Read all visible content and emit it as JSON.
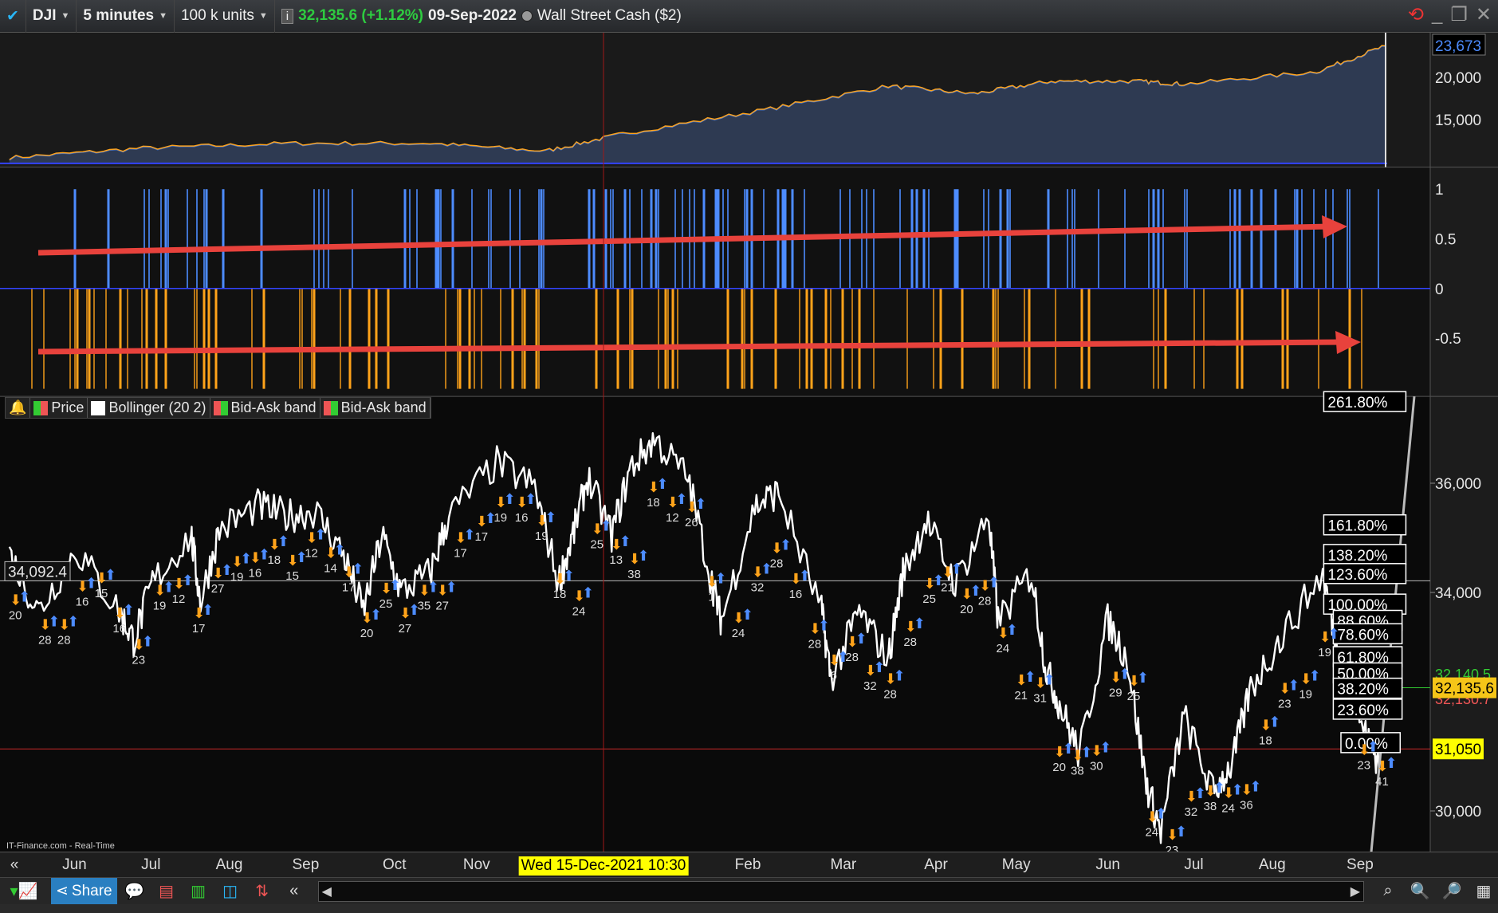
{
  "titlebar": {
    "symbol": "DJI",
    "timeframe": "5 minutes",
    "units": "100 k units",
    "price": "32,135.6 (+1.12%)",
    "date": "09-Sep-2022",
    "instrument": "Wall Street Cash ($2)"
  },
  "colors": {
    "blue": "#4d8cff",
    "orange": "#ffa31a",
    "red_arrow": "#e8423c",
    "price_line": "#ffffff",
    "yellow": "#ffff00",
    "accent": "#f5c518"
  },
  "top_panel": {
    "axis": [
      "23,673",
      "20,000",
      "15,000"
    ],
    "last": "23,673",
    "equity_keypoints": [
      [
        -0.76,
        10500
      ],
      [
        0.8,
        11632
      ],
      [
        2.5,
        12198
      ],
      [
        4.15,
        12198
      ],
      [
        5.5,
        11292
      ],
      [
        6.4,
        13330
      ],
      [
        8.05,
        16150
      ],
      [
        9.5,
        18980
      ],
      [
        10.5,
        18075
      ],
      [
        11.4,
        19547
      ],
      [
        12.4,
        19547
      ],
      [
        12.95,
        19207
      ],
      [
        14.5,
        20670
      ],
      [
        15.3,
        23726
      ]
    ]
  },
  "histogram": {
    "axis": [
      "1",
      "0.5",
      "0",
      "-0.5"
    ]
  },
  "legend": [
    "Price",
    "Bollinger (20 2)",
    "Bid-Ask band",
    "Bid-Ask band"
  ],
  "price_panel": {
    "axis": [
      {
        "v": 36000,
        "t": "36,000"
      },
      {
        "v": 34000,
        "t": "34,000"
      },
      {
        "v": 30000,
        "t": "30,000"
      }
    ],
    "cursor_price": "34,092.4",
    "last_price": "32,135.6",
    "bid": "32,140.5",
    "ask": "32,130.7",
    "level": "31,050",
    "fib_levels": [
      "261.80%",
      "161.80%",
      "138.20%",
      "123.60%",
      "100.00%",
      "88.60%",
      "78.60%",
      "61.80%",
      "50.00%",
      "38.20%",
      "23.60%",
      "0.00%"
    ],
    "price_keypoints": [
      [
        -0.76,
        34705
      ],
      [
        -0.42,
        33655
      ],
      [
        0.02,
        34793
      ],
      [
        0.52,
        33655
      ],
      [
        0.69,
        33130
      ],
      [
        0.91,
        34180
      ],
      [
        1.36,
        35055
      ],
      [
        1.47,
        33830
      ],
      [
        1.69,
        35143
      ],
      [
        2.14,
        35580
      ],
      [
        2.47,
        35405
      ],
      [
        2.81,
        35493
      ],
      [
        3.14,
        34705
      ],
      [
        3.37,
        33655
      ],
      [
        3.59,
        35055
      ],
      [
        3.81,
        34005
      ],
      [
        4.15,
        34355
      ],
      [
        4.37,
        35405
      ],
      [
        4.93,
        36368
      ],
      [
        5.37,
        35930
      ],
      [
        5.65,
        34180
      ],
      [
        5.82,
        35055
      ],
      [
        5.99,
        36105
      ],
      [
        6.27,
        35055
      ],
      [
        6.49,
        36280
      ],
      [
        6.77,
        36805
      ],
      [
        7.16,
        36105
      ],
      [
        7.44,
        34180
      ],
      [
        7.55,
        33480
      ],
      [
        7.94,
        35580
      ],
      [
        8.22,
        35843
      ],
      [
        8.72,
        33655
      ],
      [
        8.83,
        32430
      ],
      [
        9.16,
        33655
      ],
      [
        9.5,
        32780
      ],
      [
        9.67,
        34355
      ],
      [
        9.94,
        35318
      ],
      [
        10.28,
        34180
      ],
      [
        10.67,
        35405
      ],
      [
        10.78,
        33480
      ],
      [
        11.17,
        34355
      ],
      [
        11.34,
        32605
      ],
      [
        11.51,
        31905
      ],
      [
        11.73,
        31030
      ],
      [
        12.06,
        33480
      ],
      [
        12.29,
        32780
      ],
      [
        12.51,
        30505
      ],
      [
        12.68,
        29630
      ],
      [
        12.95,
        31730
      ],
      [
        13.29,
        30330
      ],
      [
        13.51,
        30855
      ],
      [
        13.73,
        32255
      ],
      [
        14.07,
        33130
      ],
      [
        14.57,
        34355
      ],
      [
        14.74,
        32955
      ],
      [
        15.07,
        31380
      ],
      [
        15.24,
        30855
      ]
    ],
    "signals": [
      "20",
      "28",
      "28",
      "16",
      "15",
      "16",
      "23",
      "19",
      "12",
      "17",
      "27",
      "19",
      "16",
      "18",
      "15",
      "12",
      "14",
      "17",
      "20",
      "25",
      "27",
      "35",
      "27",
      "17",
      "17",
      "19",
      "16",
      "19",
      "18",
      "24",
      "25",
      "13",
      "38",
      "18",
      "12",
      "26",
      "1",
      "24",
      "32",
      "28",
      "16",
      "28",
      "6",
      "28",
      "32",
      "28",
      "28",
      "25",
      "21",
      "20",
      "28",
      "24",
      "21",
      "31",
      "20",
      "38",
      "30",
      "29",
      "25",
      "24",
      "23",
      "32",
      "38",
      "24",
      "36",
      "18",
      "23",
      "19",
      "19",
      "23",
      "41"
    ],
    "source": "IT-Finance.com - Real-Time"
  },
  "date_axis": {
    "months": [
      "Jun",
      "Jul",
      "Aug",
      "Sep",
      "Oct",
      "Nov",
      "Feb",
      "Mar",
      "Apr",
      "May",
      "Jun",
      "Jul",
      "Aug",
      "Sep"
    ],
    "cursor_date": "Wed 15-Dec-2021 10:30"
  },
  "toolbar": {
    "share": "Share"
  }
}
